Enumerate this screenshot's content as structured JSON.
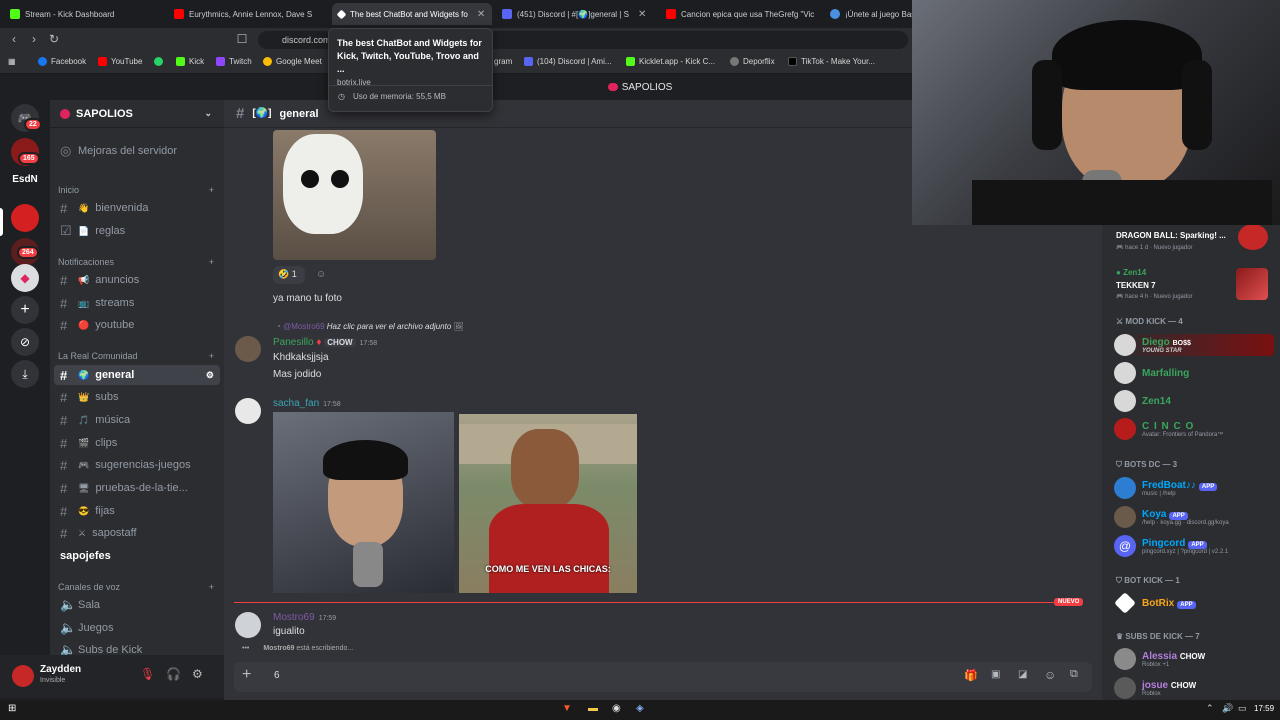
{
  "browser": {
    "tabs": [
      {
        "label": "Stream - Kick Dashboard",
        "color": "#53fc18"
      },
      {
        "label": "Eurythmics, Annie Lennox, Dave S",
        "color": "#ff0000"
      },
      {
        "label": "The best ChatBot and Widgets fo",
        "color": "#ffffff"
      },
      {
        "label": "(451) Discord | #[🌍]general | S",
        "color": "#5865f2"
      },
      {
        "label": "Cancion epica que usa TheGrefg \"Vic",
        "color": "#ff0000"
      },
      {
        "label": "¡Únete al juego Bas",
        "color": "#4a90e2"
      }
    ],
    "url": "discord.com/channels/.../1252612259348724",
    "bookmarks": [
      "Facebook",
      "YouTube",
      "Kick",
      "Twitch",
      "Google Meet",
      "gram",
      "(104) Discord | Ami...",
      "Kicklet.app - Kick C...",
      "Deporflix",
      "TikTok - Make Your..."
    ],
    "tooltip": {
      "title": "The best ChatBot and Widgets for Kick, Twitch, YouTube, Trovo and ...",
      "domain": "botrix.live",
      "memory": "Uso de memoria: 55,5 MB"
    }
  },
  "server_title": "SAPOLIOS",
  "rail": {
    "badges": [
      "22",
      "165",
      "264"
    ],
    "esdn": "EsdN"
  },
  "sidebar": {
    "server_name": "SAPOLIOS",
    "boost_item": "Mejoras del servidor",
    "categories": {
      "inicio": "Inicio",
      "notificaciones": "Notificaciones",
      "comunidad": "La Real Comunidad",
      "voz": "Canales de voz"
    },
    "inicio_channels": [
      {
        "emoji": "👋",
        "name": "bienvenida"
      },
      {
        "emoji": "📄",
        "name": "reglas"
      }
    ],
    "notif_channels": [
      {
        "emoji": "📢",
        "name": "anuncios"
      },
      {
        "emoji": "📺",
        "name": "streams"
      },
      {
        "emoji": "🔴",
        "name": "youtube"
      }
    ],
    "community_channels": [
      {
        "emoji": "🌍",
        "name": "general"
      },
      {
        "emoji": "👑",
        "name": "subs"
      },
      {
        "emoji": "🎵",
        "name": "música"
      },
      {
        "emoji": "🎬",
        "name": "clips"
      },
      {
        "emoji": "🎮",
        "name": "sugerencias-juegos"
      },
      {
        "emoji": "🖥",
        "name": "pruebas-de-la-tie..."
      },
      {
        "emoji": "😎",
        "name": "fijas"
      },
      {
        "emoji": "⚔",
        "name": "sapostaff"
      }
    ],
    "sapojefes": "sapojefes",
    "voice_channels": [
      "Sala",
      "Juegos",
      "Subs de Kick"
    ]
  },
  "user": {
    "name": "Zaydden",
    "status": "Invisible"
  },
  "chat": {
    "channel": "general",
    "reaction_count": "1",
    "msg1": "ya mano tu foto",
    "reply_user": "@Mostro69",
    "reply_text": "Haz clic para ver el archivo adjunto",
    "msg2_user": "Panesillo",
    "msg2_tag": "CHOW",
    "msg2_time": "17:58",
    "msg2_lines": [
      "Khdkaksjjsja",
      "Mas jodido"
    ],
    "msg3_user": "sacha_fan",
    "msg3_time": "17:58",
    "meme_caption": "COMO ME VEN LAS CHICAS:",
    "new_label": "NUEVO",
    "msg4_user": "Mostro69",
    "msg4_time": "17:59",
    "msg4_text": "igualito",
    "typing_user": "Mostro69",
    "typing_text": " está escribiendo...",
    "composer_value": "6"
  },
  "members": {
    "activity1": {
      "game": "DRAGON BALL: Sparking! ...",
      "when": "hace 1 d",
      "tag": "Nuevo jugador",
      "user": "Zen14"
    },
    "activity2": {
      "user": "Zen14",
      "game": "TEKKEN 7",
      "when": "hace 4 h",
      "tag": "Nuevo jugador"
    },
    "groups": {
      "mod": "MOD KICK — 4",
      "bots": "BOTS DC — 3",
      "botkick": "BOT KICK — 1",
      "subs": "SUBS DE KICK — 7"
    },
    "mods": [
      {
        "name": "Diego",
        "color": "#3ba55c",
        "sub": "YOUNG STAR",
        "tag": "BO$$"
      },
      {
        "name": "Marfalling",
        "color": "#3ba55c",
        "sub": ""
      },
      {
        "name": "Zen14",
        "color": "#3ba55c",
        "sub": ""
      },
      {
        "name": "C I N C O",
        "color": "#3ba55c",
        "sub": "Avatar: Frontiers of Pandora™"
      }
    ],
    "bots": [
      {
        "name": "FredBoat♪♪",
        "sub": "music | /help",
        "color": "#00a8fc"
      },
      {
        "name": "Koya",
        "sub": "/help · koya.gg · discord.gg/koya",
        "color": "#00a8fc"
      },
      {
        "name": "Pingcord",
        "sub": "pingcord.xyz | ?pingcord | v2.2.1",
        "color": "#00a8fc"
      }
    ],
    "botkick": [
      {
        "name": "BotRix",
        "color": "#faa61a"
      }
    ],
    "subs": [
      {
        "name": "Alessia",
        "sub": "Roblox +1",
        "tag": "CHOW",
        "color": "#b57edc"
      },
      {
        "name": "josue",
        "sub": "Roblox",
        "tag": "CHOW",
        "color": "#b57edc"
      }
    ],
    "app_label": "APP"
  },
  "taskbar": {
    "time": "17:59"
  }
}
